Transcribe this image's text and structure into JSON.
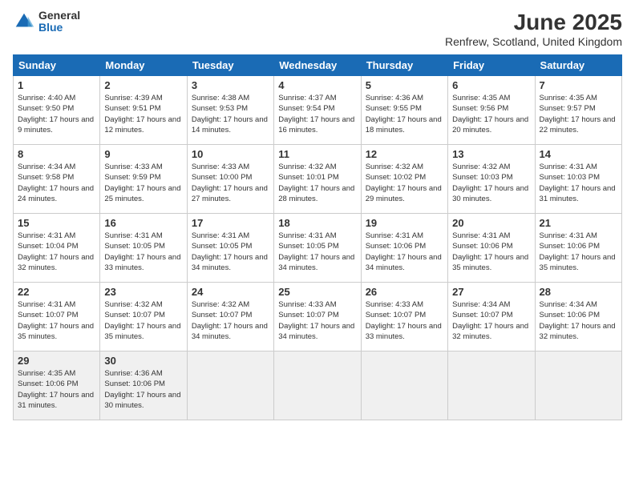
{
  "logo": {
    "general": "General",
    "blue": "Blue"
  },
  "title": "June 2025",
  "location": "Renfrew, Scotland, United Kingdom",
  "days_header": [
    "Sunday",
    "Monday",
    "Tuesday",
    "Wednesday",
    "Thursday",
    "Friday",
    "Saturday"
  ],
  "weeks": [
    [
      {
        "day": 1,
        "sunrise": "4:40 AM",
        "sunset": "9:50 PM",
        "daylight": "17 hours and 9 minutes."
      },
      {
        "day": 2,
        "sunrise": "4:39 AM",
        "sunset": "9:51 PM",
        "daylight": "17 hours and 12 minutes."
      },
      {
        "day": 3,
        "sunrise": "4:38 AM",
        "sunset": "9:53 PM",
        "daylight": "17 hours and 14 minutes."
      },
      {
        "day": 4,
        "sunrise": "4:37 AM",
        "sunset": "9:54 PM",
        "daylight": "17 hours and 16 minutes."
      },
      {
        "day": 5,
        "sunrise": "4:36 AM",
        "sunset": "9:55 PM",
        "daylight": "17 hours and 18 minutes."
      },
      {
        "day": 6,
        "sunrise": "4:35 AM",
        "sunset": "9:56 PM",
        "daylight": "17 hours and 20 minutes."
      },
      {
        "day": 7,
        "sunrise": "4:35 AM",
        "sunset": "9:57 PM",
        "daylight": "17 hours and 22 minutes."
      }
    ],
    [
      {
        "day": 8,
        "sunrise": "4:34 AM",
        "sunset": "9:58 PM",
        "daylight": "17 hours and 24 minutes."
      },
      {
        "day": 9,
        "sunrise": "4:33 AM",
        "sunset": "9:59 PM",
        "daylight": "17 hours and 25 minutes."
      },
      {
        "day": 10,
        "sunrise": "4:33 AM",
        "sunset": "10:00 PM",
        "daylight": "17 hours and 27 minutes."
      },
      {
        "day": 11,
        "sunrise": "4:32 AM",
        "sunset": "10:01 PM",
        "daylight": "17 hours and 28 minutes."
      },
      {
        "day": 12,
        "sunrise": "4:32 AM",
        "sunset": "10:02 PM",
        "daylight": "17 hours and 29 minutes."
      },
      {
        "day": 13,
        "sunrise": "4:32 AM",
        "sunset": "10:03 PM",
        "daylight": "17 hours and 30 minutes."
      },
      {
        "day": 14,
        "sunrise": "4:31 AM",
        "sunset": "10:03 PM",
        "daylight": "17 hours and 31 minutes."
      }
    ],
    [
      {
        "day": 15,
        "sunrise": "4:31 AM",
        "sunset": "10:04 PM",
        "daylight": "17 hours and 32 minutes."
      },
      {
        "day": 16,
        "sunrise": "4:31 AM",
        "sunset": "10:05 PM",
        "daylight": "17 hours and 33 minutes."
      },
      {
        "day": 17,
        "sunrise": "4:31 AM",
        "sunset": "10:05 PM",
        "daylight": "17 hours and 34 minutes."
      },
      {
        "day": 18,
        "sunrise": "4:31 AM",
        "sunset": "10:05 PM",
        "daylight": "17 hours and 34 minutes."
      },
      {
        "day": 19,
        "sunrise": "4:31 AM",
        "sunset": "10:06 PM",
        "daylight": "17 hours and 34 minutes."
      },
      {
        "day": 20,
        "sunrise": "4:31 AM",
        "sunset": "10:06 PM",
        "daylight": "17 hours and 35 minutes."
      },
      {
        "day": 21,
        "sunrise": "4:31 AM",
        "sunset": "10:06 PM",
        "daylight": "17 hours and 35 minutes."
      }
    ],
    [
      {
        "day": 22,
        "sunrise": "4:31 AM",
        "sunset": "10:07 PM",
        "daylight": "17 hours and 35 minutes."
      },
      {
        "day": 23,
        "sunrise": "4:32 AM",
        "sunset": "10:07 PM",
        "daylight": "17 hours and 35 minutes."
      },
      {
        "day": 24,
        "sunrise": "4:32 AM",
        "sunset": "10:07 PM",
        "daylight": "17 hours and 34 minutes."
      },
      {
        "day": 25,
        "sunrise": "4:33 AM",
        "sunset": "10:07 PM",
        "daylight": "17 hours and 34 minutes."
      },
      {
        "day": 26,
        "sunrise": "4:33 AM",
        "sunset": "10:07 PM",
        "daylight": "17 hours and 33 minutes."
      },
      {
        "day": 27,
        "sunrise": "4:34 AM",
        "sunset": "10:07 PM",
        "daylight": "17 hours and 32 minutes."
      },
      {
        "day": 28,
        "sunrise": "4:34 AM",
        "sunset": "10:06 PM",
        "daylight": "17 hours and 32 minutes."
      }
    ],
    [
      {
        "day": 29,
        "sunrise": "4:35 AM",
        "sunset": "10:06 PM",
        "daylight": "17 hours and 31 minutes."
      },
      {
        "day": 30,
        "sunrise": "4:36 AM",
        "sunset": "10:06 PM",
        "daylight": "17 hours and 30 minutes."
      },
      null,
      null,
      null,
      null,
      null
    ]
  ]
}
